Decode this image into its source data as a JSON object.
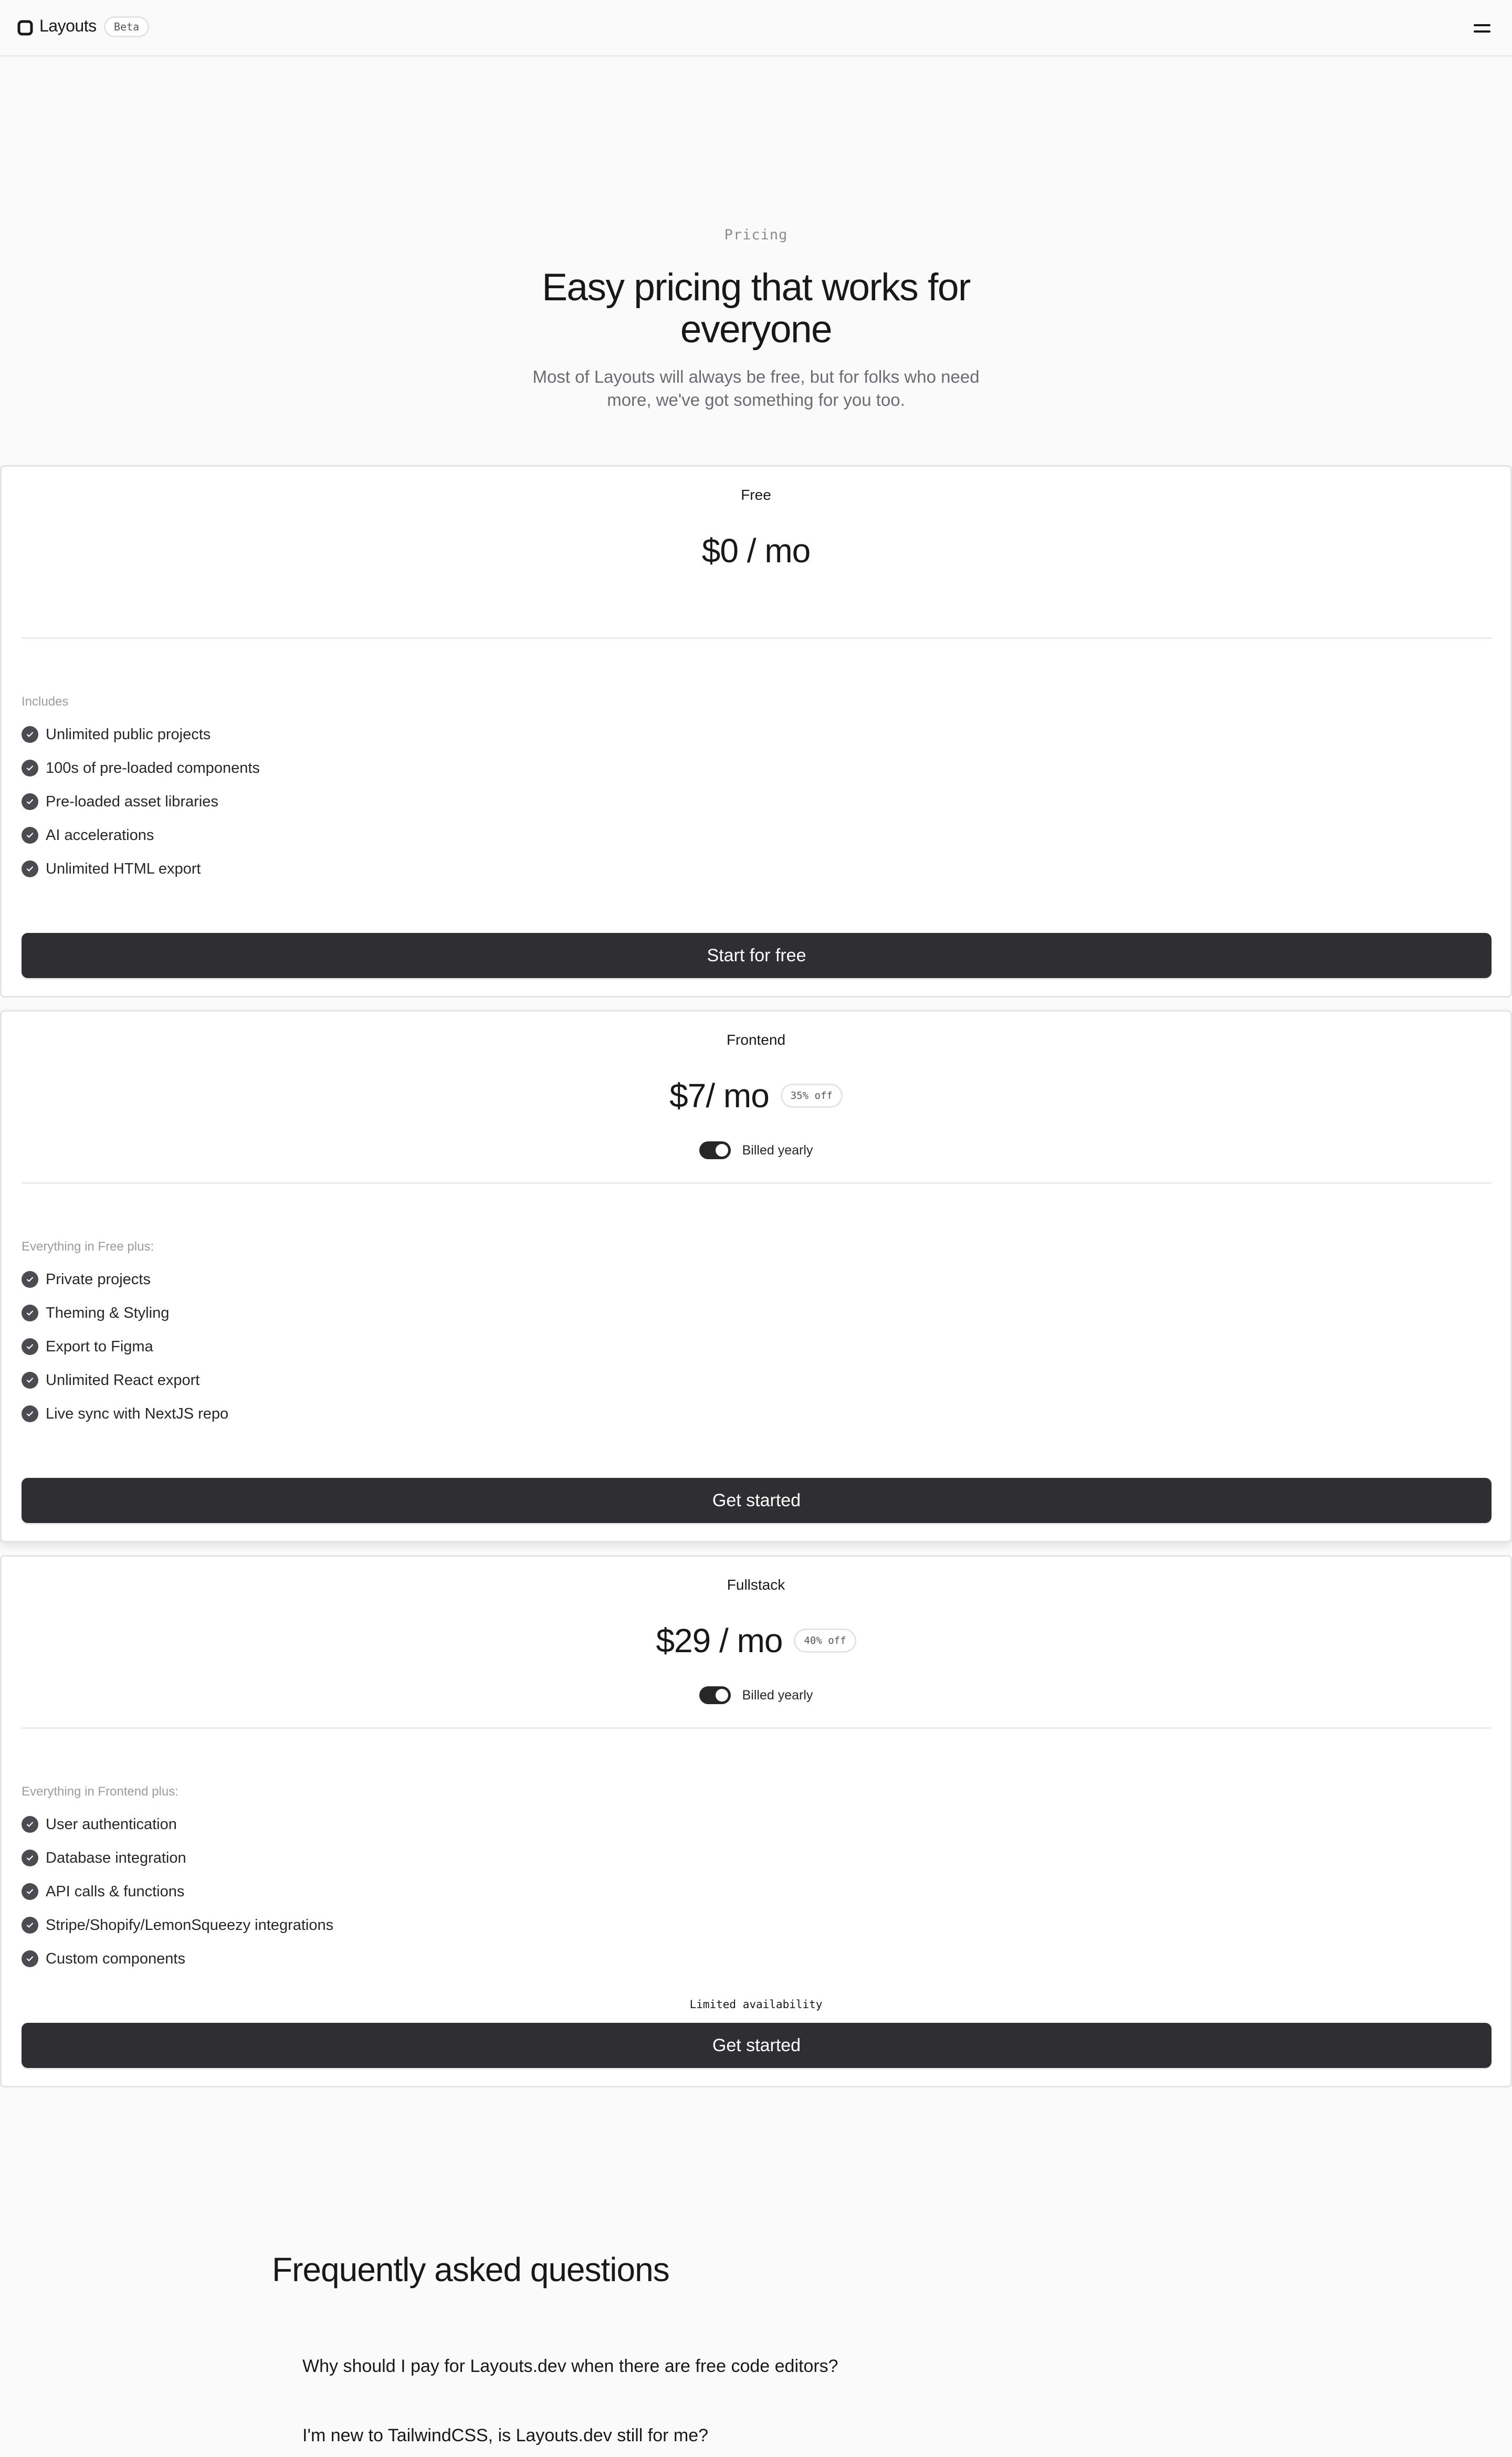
{
  "header": {
    "brand": "Layouts",
    "badge": "Beta",
    "logo_icon": "rounded-square-logo-icon",
    "menu_icon": "hamburger-menu-icon"
  },
  "hero": {
    "eyebrow": "Pricing",
    "title": "Easy pricing that works for everyone",
    "subtitle": "Most of Layouts will always be free, but for folks who need more, we've got something for you too."
  },
  "plans": [
    {
      "name": "Free",
      "price": "$0 / mo",
      "includes_label": "Includes",
      "features": [
        "Unlimited public projects",
        "100s of pre-loaded components",
        "Pre-loaded asset libraries",
        "AI accelerations",
        "Unlimited HTML export"
      ],
      "cta": "Start for free"
    },
    {
      "name": "Frontend",
      "price": "$7/ mo",
      "discount": "35% off",
      "billing": "Billed yearly",
      "billing_yearly_on": true,
      "includes_label": "Everything in Free plus:",
      "features": [
        "Private projects",
        "Theming & Styling",
        "Export to Figma",
        "Unlimited React export",
        "Live sync with NextJS repo"
      ],
      "cta": "Get started"
    },
    {
      "name": "Fullstack",
      "price": "$29 / mo",
      "discount": "40% off",
      "billing": "Billed yearly",
      "billing_yearly_on": true,
      "includes_label": "Everything in Frontend plus:",
      "features": [
        "User authentication",
        "Database integration",
        "API calls & functions",
        "Stripe/Shopify/LemonSqueezy integrations",
        "Custom components"
      ],
      "note": "Limited availability",
      "cta": "Get started"
    }
  ],
  "faq": {
    "title": "Frequently asked questions",
    "questions": [
      "Why should I pay for Layouts.dev when there are free code editors?",
      "I'm new to TailwindCSS, is Layouts.dev still for me?"
    ]
  },
  "colors": {
    "background": "#fafafa",
    "card": "#ffffff",
    "button": "#2f2f33",
    "text": "#18181b",
    "muted": "#9b9ba2"
  }
}
